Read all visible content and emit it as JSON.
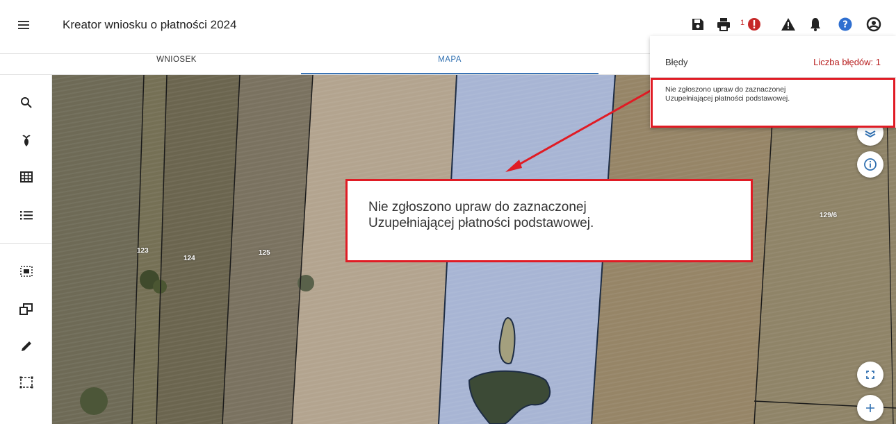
{
  "app": {
    "title": "Kreator wniosku o płatności 2024"
  },
  "header": {
    "icons": [
      "save-icon",
      "print-icon",
      "error-icon",
      "warning-icon",
      "notification-bell-icon",
      "help-icon",
      "account-icon"
    ],
    "error_count": "1",
    "colors": {
      "error": "#c62828",
      "help": "#2f6fd0",
      "icon": "#222222"
    }
  },
  "tabs": [
    {
      "label": "WNIOSEK",
      "active": false
    },
    {
      "label": "MAPA",
      "active": true
    }
  ],
  "toolbar": {
    "tools": [
      "search-icon",
      "crop-plant-icon",
      "grid-table-icon",
      "list-icon",
      "select-area-icon",
      "copy-shape-icon",
      "pencil-edit-icon",
      "bounding-box-icon"
    ]
  },
  "errors_panel": {
    "title": "Błędy",
    "count_label": "Liczba błędów: 1",
    "items": [
      {
        "line1": "Nie zgłoszono upraw do zaznaczonej",
        "line2": "Uzupełniającej płatności podstawowej."
      }
    ]
  },
  "callout": {
    "line1": "Nie zgłoszono upraw do zaznaczonej",
    "line2": "Uzupełniającej płatności podstawowej.",
    "border_color": "#e01b24"
  },
  "map": {
    "parcel_labels": [
      "123",
      "124",
      "125",
      "129/6"
    ],
    "controls": [
      "layers-icon",
      "info-icon",
      "fullscreen-icon",
      "zoom-in-icon"
    ],
    "selected_parcel_color": "#a8b8e0"
  }
}
